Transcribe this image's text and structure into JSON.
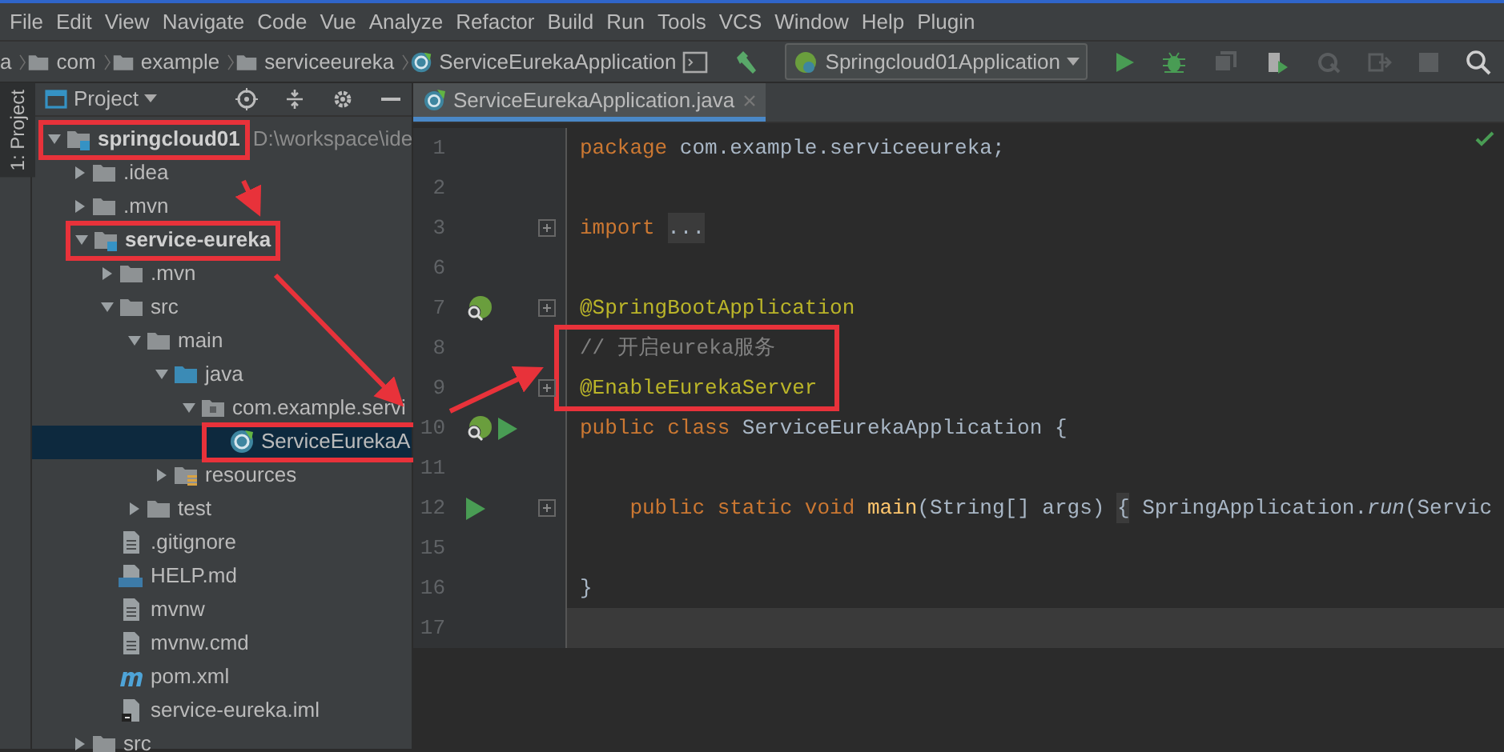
{
  "menu": [
    "File",
    "Edit",
    "View",
    "Navigate",
    "Code",
    "Vue",
    "Analyze",
    "Refactor",
    "Build",
    "Run",
    "Tools",
    "VCS",
    "Window",
    "Help",
    "Plugin"
  ],
  "breadcrumb": [
    {
      "label": "a"
    },
    {
      "label": "com",
      "kind": "folder"
    },
    {
      "label": "example",
      "kind": "folder"
    },
    {
      "label": "serviceeureka",
      "kind": "folder"
    },
    {
      "label": "ServiceEurekaApplication",
      "kind": "class"
    }
  ],
  "run_config": "Springcloud01Application",
  "tool_window_stripe": "1: Project",
  "project_panel": {
    "title": "Project",
    "tree": [
      {
        "label": "springcloud01",
        "suffix": "D:\\workspace\\ide",
        "kind": "module",
        "highlighted": true,
        "selected": false,
        "expanded": true,
        "children": [
          {
            "label": ".idea",
            "kind": "folder",
            "highlighted": false,
            "selected": false,
            "expanded": false
          },
          {
            "label": ".mvn",
            "kind": "folder",
            "highlighted": false,
            "selected": false,
            "expanded": false
          },
          {
            "label": "service-eureka",
            "kind": "module",
            "highlighted": true,
            "selected": false,
            "expanded": true,
            "children": [
              {
                "label": ".mvn",
                "kind": "folder",
                "highlighted": false,
                "selected": false,
                "expanded": false
              },
              {
                "label": "src",
                "kind": "folder",
                "highlighted": false,
                "selected": false,
                "expanded": true,
                "children": [
                  {
                    "label": "main",
                    "kind": "folder",
                    "highlighted": false,
                    "selected": false,
                    "expanded": true,
                    "children": [
                      {
                        "label": "java",
                        "kind": "source",
                        "highlighted": false,
                        "selected": false,
                        "expanded": true,
                        "children": [
                          {
                            "label": "com.example.servi",
                            "kind": "package",
                            "highlighted": false,
                            "selected": false,
                            "expanded": true,
                            "children": [
                              {
                                "label": "ServiceEurekaA",
                                "kind": "class",
                                "highlighted": true,
                                "selected": true
                              }
                            ]
                          }
                        ]
                      },
                      {
                        "label": "resources",
                        "kind": "resources",
                        "highlighted": false,
                        "selected": false,
                        "expanded": false
                      }
                    ]
                  },
                  {
                    "label": "test",
                    "kind": "folder",
                    "highlighted": false,
                    "selected": false,
                    "expanded": false
                  }
                ]
              },
              {
                "label": ".gitignore",
                "kind": "file",
                "highlighted": false,
                "selected": false
              },
              {
                "label": "HELP.md",
                "kind": "markdown",
                "highlighted": false,
                "selected": false
              },
              {
                "label": "mvnw",
                "kind": "file",
                "highlighted": false,
                "selected": false
              },
              {
                "label": "mvnw.cmd",
                "kind": "file",
                "highlighted": false,
                "selected": false
              },
              {
                "label": "pom.xml",
                "kind": "maven",
                "highlighted": false,
                "selected": false
              },
              {
                "label": "service-eureka.iml",
                "kind": "iml",
                "highlighted": false,
                "selected": false
              }
            ]
          },
          {
            "label": "src",
            "kind": "folder",
            "highlighted": false,
            "selected": false,
            "expanded": false
          }
        ]
      }
    ]
  },
  "editor": {
    "tab": {
      "label": "ServiceEurekaApplication.java",
      "selected": true
    },
    "lines": [
      {
        "number": "1",
        "fold": false,
        "current": false,
        "highlighted": false,
        "tokens": [
          {
            "kind": "keyword",
            "text": "package"
          },
          {
            "kind": "plain",
            "text": " com.example.serviceeureka;"
          }
        ]
      },
      {
        "number": "2",
        "fold": false,
        "current": false,
        "highlighted": false
      },
      {
        "number": "3",
        "fold": true,
        "current": false,
        "highlighted": false,
        "tokens": [
          {
            "kind": "keyword",
            "text": "import "
          },
          {
            "kind": "folded",
            "text": "..."
          }
        ]
      },
      {
        "number": "6",
        "fold": false,
        "current": false,
        "highlighted": false
      },
      {
        "number": "7",
        "fold": true,
        "current": false,
        "highlighted": false,
        "gutter": [
          {
            "kind": "bean"
          }
        ],
        "tokens": [
          {
            "kind": "annotation",
            "text": "@SpringBootApplication"
          }
        ]
      },
      {
        "number": "8",
        "fold": false,
        "current": false,
        "highlighted": true,
        "tokens": [
          {
            "kind": "comment",
            "text": "// 开启eureka服务"
          }
        ]
      },
      {
        "number": "9",
        "fold": true,
        "current": false,
        "highlighted": true,
        "tokens": [
          {
            "kind": "annotation",
            "text": "@EnableEurekaServer"
          }
        ]
      },
      {
        "number": "10",
        "fold": false,
        "current": false,
        "highlighted": false,
        "gutter": [
          {
            "kind": "bean"
          },
          {
            "kind": "run"
          }
        ],
        "tokens": [
          {
            "kind": "keyword",
            "text": "public class"
          },
          {
            "kind": "plain",
            "text": " ServiceEurekaApplication {"
          }
        ]
      },
      {
        "number": "11",
        "fold": false,
        "current": false,
        "highlighted": false
      },
      {
        "number": "12",
        "fold": true,
        "current": false,
        "highlighted": false,
        "gutter": [
          {
            "kind": "run"
          }
        ],
        "tokens": [
          {
            "kind": "keyword",
            "text": "    public static void "
          },
          {
            "kind": "method",
            "text": "main"
          },
          {
            "kind": "plain",
            "text": "(String[] args) "
          },
          {
            "kind": "folded",
            "text": "{"
          },
          {
            "kind": "plain",
            "text": " SpringApplication."
          },
          {
            "kind": "static",
            "text": "run"
          },
          {
            "kind": "plain",
            "text": "(Servic"
          }
        ]
      },
      {
        "number": "15",
        "fold": false,
        "current": false,
        "highlighted": false
      },
      {
        "number": "16",
        "fold": false,
        "current": false,
        "highlighted": false,
        "tokens": [
          {
            "kind": "plain",
            "text": "}"
          }
        ]
      },
      {
        "number": "17",
        "fold": false,
        "current": true,
        "highlighted": false
      }
    ]
  }
}
